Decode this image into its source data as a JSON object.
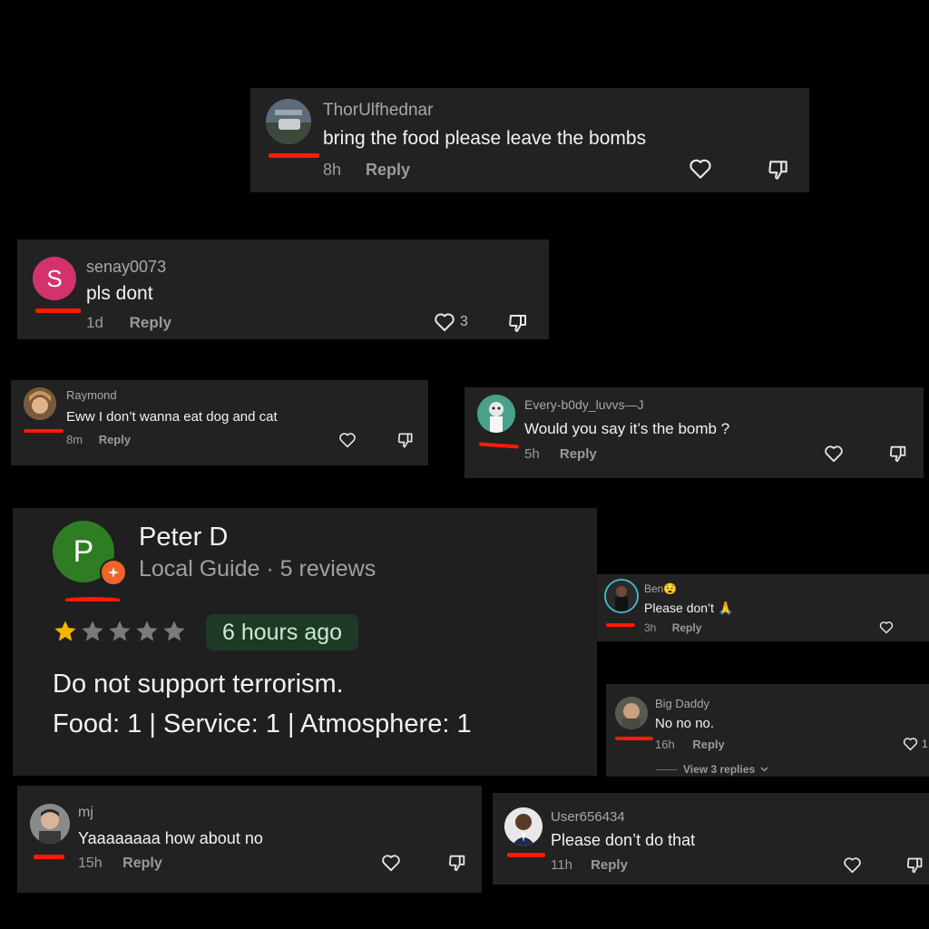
{
  "colors": {
    "background": "#000000",
    "card": "#222222",
    "redline": "#ff1a00",
    "google_green": "#2e7d23",
    "local_guide_badge": "#f0642b",
    "star_filled": "#f6b400",
    "star_empty": "#7a7a7a",
    "time_badge_bg": "#1e3a26",
    "time_badge_text": "#c9eccf"
  },
  "comments": [
    {
      "username": "ThorUlfhednar",
      "text": "bring the food please leave the bombs",
      "time": "8h",
      "reply": "Reply"
    },
    {
      "username": "senay0073",
      "avatar_letter": "S",
      "text": "pls dont",
      "time": "1d",
      "reply": "Reply",
      "likes": "3"
    },
    {
      "username": "Raymond",
      "text": "Eww I don’t wanna eat dog and cat",
      "time": "8m",
      "reply": "Reply"
    },
    {
      "username": "Every-b0dy_luvvs—J",
      "text": "Would you say it’s the bomb ?",
      "time": "5h",
      "reply": "Reply"
    },
    {
      "username": "Ben😧",
      "text": "Please don’t 🙏",
      "time": "3h",
      "reply": "Reply"
    },
    {
      "username": "Big Daddy",
      "text": "No no no.",
      "time": "16h",
      "reply": "Reply",
      "likes": "1",
      "view_replies": "View 3 replies"
    },
    {
      "username": "mj",
      "text": "Yaaaaaaaa how about no",
      "time": "15h",
      "reply": "Reply"
    },
    {
      "username": "User656434",
      "text": "Please don’t do that",
      "time": "11h",
      "reply": "Reply"
    }
  ],
  "review": {
    "avatar_letter": "P",
    "name": "Peter D",
    "subtitle": "Local Guide · 5 reviews",
    "rating": 1,
    "max_rating": 5,
    "time": "6 hours ago",
    "body": "Do not support terrorism.",
    "scores": "Food: 1 | Service: 1 | Atmosphere: 1"
  }
}
